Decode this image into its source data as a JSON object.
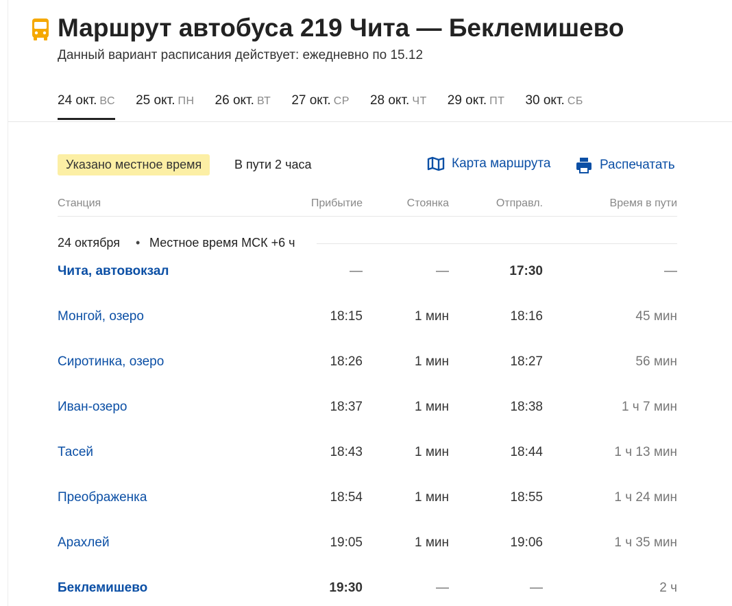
{
  "header": {
    "title": "Маршрут автобуса 219 Чита — Беклемишево",
    "subtitle": "Данный вариант расписания действует: ежедневно по 15.12",
    "icon": "bus-icon",
    "accent": "#f5a800"
  },
  "tabs": [
    {
      "date": "24 окт.",
      "weekday": "ВС",
      "active": true
    },
    {
      "date": "25 окт.",
      "weekday": "ПН",
      "active": false
    },
    {
      "date": "26 окт.",
      "weekday": "ВТ",
      "active": false
    },
    {
      "date": "27 окт.",
      "weekday": "СР",
      "active": false
    },
    {
      "date": "28 окт.",
      "weekday": "ЧТ",
      "active": false
    },
    {
      "date": "29 окт.",
      "weekday": "ПТ",
      "active": false
    },
    {
      "date": "30 окт.",
      "weekday": "СБ",
      "active": false
    }
  ],
  "info": {
    "badge": "Указано местное время",
    "duration": "В пути 2 часа"
  },
  "actions": {
    "map_label": "Карта маршрута",
    "map_icon": "map-icon",
    "print_label": "Распечатать",
    "print_icon": "printer-icon",
    "link_color": "#0b4fa5"
  },
  "table": {
    "headers": {
      "station": "Станция",
      "arrival": "Прибытие",
      "stop": "Стоянка",
      "departure": "Отправл.",
      "travel": "Время в пути"
    },
    "date": "24 октября",
    "dot": "•",
    "timezone": "Местное время МСК +6 ч",
    "rows": [
      {
        "station": "Чита, автовокзал",
        "arrival": "—",
        "stop": "—",
        "departure": "17:30",
        "travel": "—",
        "bold": true
      },
      {
        "station": "Монгой, озеро",
        "arrival": "18:15",
        "stop": "1 мин",
        "departure": "18:16",
        "travel": "45 мин",
        "bold": false
      },
      {
        "station": "Сиротинка, озеро",
        "arrival": "18:26",
        "stop": "1 мин",
        "departure": "18:27",
        "travel": "56 мин",
        "bold": false
      },
      {
        "station": "Иван-озеро",
        "arrival": "18:37",
        "stop": "1 мин",
        "departure": "18:38",
        "travel": "1 ч 7 мин",
        "bold": false
      },
      {
        "station": "Тасей",
        "arrival": "18:43",
        "stop": "1 мин",
        "departure": "18:44",
        "travel": "1 ч 13 мин",
        "bold": false
      },
      {
        "station": "Преображенка",
        "arrival": "18:54",
        "stop": "1 мин",
        "departure": "18:55",
        "travel": "1 ч 24 мин",
        "bold": false
      },
      {
        "station": "Арахлей",
        "arrival": "19:05",
        "stop": "1 мин",
        "departure": "19:06",
        "travel": "1 ч 35 мин",
        "bold": false
      },
      {
        "station": "Беклемишево",
        "arrival": "19:30",
        "stop": "—",
        "departure": "—",
        "travel": "2 ч",
        "bold": true
      }
    ]
  }
}
